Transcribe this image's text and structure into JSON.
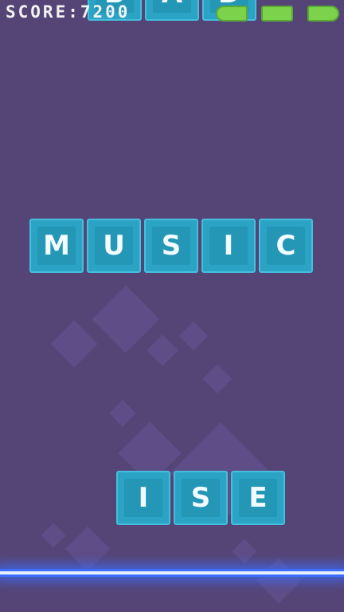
{
  "hud": {
    "score_label": "SCORE:",
    "score_value": "7200",
    "health_segments": 3
  },
  "words": {
    "top_partial": [
      "B",
      "A",
      "D"
    ],
    "middle": [
      "M",
      "U",
      "S",
      "I",
      "C"
    ],
    "bottom": [
      "I",
      "S",
      "E"
    ]
  },
  "colors": {
    "background": "#554577",
    "tile": "#2aa3c4",
    "health": "#7cd24a",
    "laser": "#3b6cff"
  }
}
